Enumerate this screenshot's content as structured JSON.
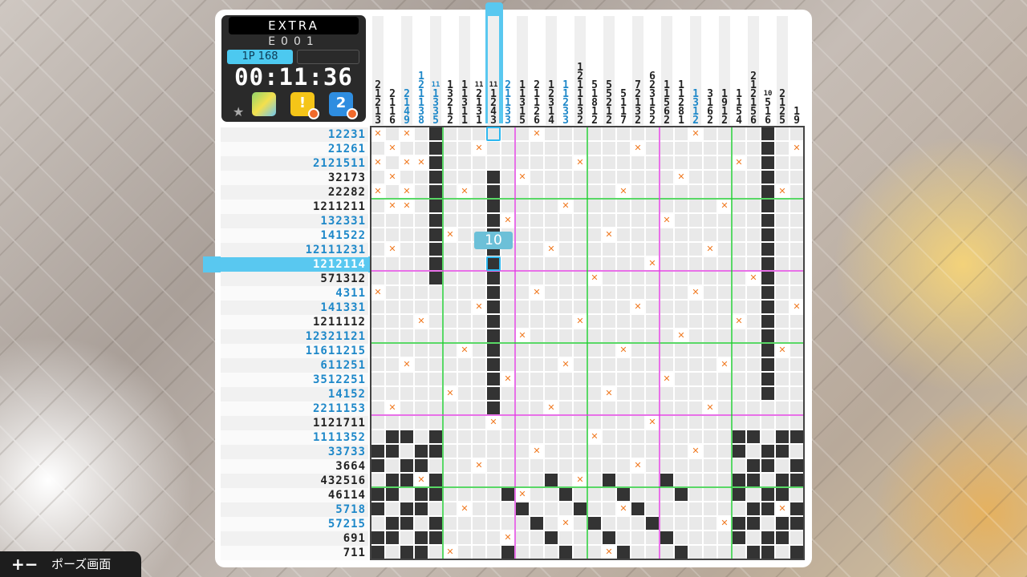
{
  "info": {
    "mode": "EXTRA",
    "code": "E001",
    "player": "1P 168",
    "timer": "00:11:36"
  },
  "tooltip": "10",
  "footer": {
    "label": "ポーズ画面",
    "icon": "plus-minus-icon"
  },
  "colors": {
    "number_blue": "#1e88c9",
    "number_done": "#888888",
    "filled": "#333333",
    "mark_x": "#f07a22",
    "highlight": "#59c8f0"
  },
  "row_clues": [
    "12231",
    "21261",
    "2121511",
    "32173",
    "22282",
    "1211211",
    "132331",
    "141522",
    "12111231",
    "1212114",
    "571312",
    "4311",
    "141331",
    "1211112",
    "12321121",
    "11611215",
    "611251",
    "3512251",
    "14152",
    "2211153",
    "1121711",
    "1111352",
    "33733",
    "3664",
    "432516",
    "46114",
    "5718",
    "57215",
    "691",
    "711"
  ],
  "col_clues": [
    [
      "2",
      "1",
      "2",
      "1",
      "3"
    ],
    [
      "2",
      "1",
      "1",
      "6"
    ],
    [
      "2",
      "1",
      "4",
      "9"
    ],
    [
      "1",
      "2",
      "1",
      "1",
      "3",
      "8"
    ],
    [
      "11",
      "1",
      "3",
      "3",
      "5"
    ],
    [
      "1",
      "3",
      "2",
      "1",
      "2"
    ],
    [
      "1",
      "1",
      "3",
      "1",
      "1"
    ],
    [
      "11",
      "2",
      "1",
      "3",
      "1"
    ],
    [
      "11",
      "1",
      "2",
      "4",
      "3"
    ],
    [
      "2",
      "1",
      "1",
      "3",
      "3"
    ],
    [
      "1",
      "1",
      "3",
      "1",
      "5"
    ],
    [
      "2",
      "1",
      "1",
      "2",
      "6"
    ],
    [
      "1",
      "2",
      "3",
      "1",
      "4"
    ],
    [
      "1",
      "1",
      "2",
      "3",
      "3"
    ],
    [
      "1",
      "2",
      "1",
      "1",
      "1",
      "3",
      "2"
    ],
    [
      "5",
      "1",
      "8",
      "1",
      "2"
    ],
    [
      "5",
      "5",
      "2",
      "1",
      "2"
    ],
    [
      "5",
      "1",
      "1",
      "7"
    ],
    [
      "7",
      "2",
      "1",
      "3",
      "2"
    ],
    [
      "6",
      "2",
      "3",
      "1",
      "5",
      "2"
    ],
    [
      "1",
      "1",
      "5",
      "6",
      "2"
    ],
    [
      "1",
      "1",
      "2",
      "8",
      "1"
    ],
    [
      "1",
      "3",
      "1",
      "2"
    ],
    [
      "3",
      "1",
      "6",
      "2"
    ],
    [
      "1",
      "9",
      "1",
      "2"
    ],
    [
      "1",
      "1",
      "5",
      "4"
    ],
    [
      "2",
      "1",
      "2",
      "1",
      "5",
      "6"
    ],
    [
      "10",
      "5",
      "1",
      "6"
    ],
    [
      "2",
      "1",
      "2",
      "5"
    ],
    [
      "1",
      "9"
    ]
  ]
}
